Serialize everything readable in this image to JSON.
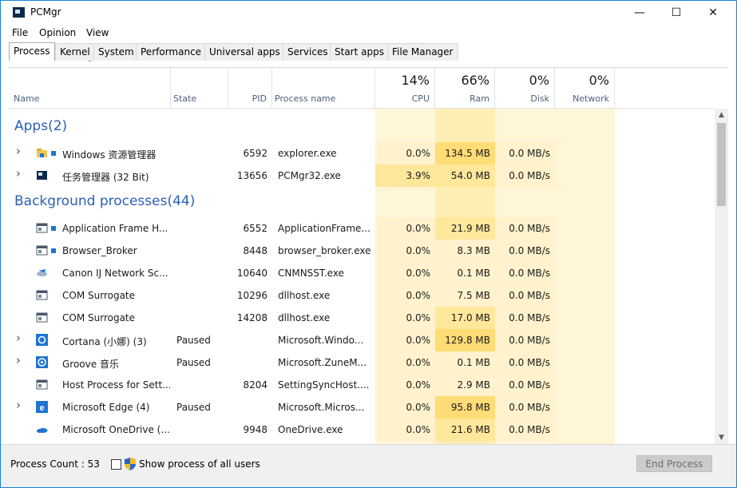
{
  "window": {
    "title": "PCMgr",
    "minimize_glyph": "—",
    "maximize_glyph": "☐",
    "close_glyph": "✕"
  },
  "menu": [
    "File",
    "Opinion",
    "View"
  ],
  "tabs": [
    "Process",
    "Kernel",
    "System",
    "Performance",
    "Universal apps",
    "Services",
    "Start apps",
    "File Manager"
  ],
  "active_tab": "Process",
  "columns": {
    "name": "Name",
    "state": "State",
    "pid": "PID",
    "process_name": "Process name",
    "cpu": {
      "label": "CPU",
      "pct": "14%"
    },
    "ram": {
      "label": "Ram",
      "pct": "66%"
    },
    "disk": {
      "label": "Disk",
      "pct": "0%"
    },
    "network": {
      "label": "Network",
      "pct": "0%"
    }
  },
  "groups": [
    {
      "title": "Apps(2)",
      "rows": [
        {
          "name": "Windows 资源管理器",
          "state": "",
          "pid": "6592",
          "process": "explorer.exe",
          "cpu": "0.0%",
          "ram": "134.5 MB",
          "disk": "0.0 MB/s",
          "expand": true,
          "icon": "folder-icon",
          "dot": true
        },
        {
          "name": "任务管理器 (32 Bit)",
          "state": "",
          "pid": "13656",
          "process": "PCMgr32.exe",
          "cpu": "3.9%",
          "ram": "54.0 MB",
          "disk": "0.0 MB/s",
          "expand": true,
          "icon": "taskmgr-icon",
          "dot": false
        }
      ]
    },
    {
      "title": "Background processes(44)",
      "rows": [
        {
          "name": "Application Frame H...",
          "state": "",
          "pid": "6552",
          "process": "ApplicationFrame...",
          "cpu": "0.0%",
          "ram": "21.9 MB",
          "disk": "0.0 MB/s",
          "expand": false,
          "icon": "window-icon",
          "dot": true
        },
        {
          "name": "Browser_Broker",
          "state": "",
          "pid": "8448",
          "process": "browser_broker.exe",
          "cpu": "0.0%",
          "ram": "8.3 MB",
          "disk": "0.0 MB/s",
          "expand": false,
          "icon": "window-icon",
          "dot": true
        },
        {
          "name": "Canon IJ Network Sc...",
          "state": "",
          "pid": "10640",
          "process": "CNMNSST.exe",
          "cpu": "0.0%",
          "ram": "0.1 MB",
          "disk": "0.0 MB/s",
          "expand": false,
          "icon": "scanner-icon",
          "dot": false
        },
        {
          "name": "COM Surrogate",
          "state": "",
          "pid": "10296",
          "process": "dllhost.exe",
          "cpu": "0.0%",
          "ram": "7.5 MB",
          "disk": "0.0 MB/s",
          "expand": false,
          "icon": "window-icon",
          "dot": false
        },
        {
          "name": "COM Surrogate",
          "state": "",
          "pid": "14208",
          "process": "dllhost.exe",
          "cpu": "0.0%",
          "ram": "17.0 MB",
          "disk": "0.0 MB/s",
          "expand": false,
          "icon": "window-icon",
          "dot": false
        },
        {
          "name": "Cortana (小娜) (3)",
          "state": "Paused",
          "pid": "",
          "process": "Microsoft.Windo...",
          "cpu": "0.0%",
          "ram": "129.8 MB",
          "disk": "0.0 MB/s",
          "expand": true,
          "icon": "cortana-icon",
          "dot": false
        },
        {
          "name": "Groove 音乐",
          "state": "Paused",
          "pid": "",
          "process": "Microsoft.ZuneM...",
          "cpu": "0.0%",
          "ram": "0.1 MB",
          "disk": "0.0 MB/s",
          "expand": true,
          "icon": "groove-icon",
          "dot": false
        },
        {
          "name": "Host Process for Sett...",
          "state": "",
          "pid": "8204",
          "process": "SettingSyncHost....",
          "cpu": "0.0%",
          "ram": "2.9 MB",
          "disk": "0.0 MB/s",
          "expand": false,
          "icon": "window-icon",
          "dot": false
        },
        {
          "name": "Microsoft Edge (4)",
          "state": "Paused",
          "pid": "",
          "process": "Microsoft.Micros...",
          "cpu": "0.0%",
          "ram": "95.8 MB",
          "disk": "0.0 MB/s",
          "expand": true,
          "icon": "edge-icon",
          "dot": false
        },
        {
          "name": "Microsoft OneDrive (...",
          "state": "",
          "pid": "9948",
          "process": "OneDrive.exe",
          "cpu": "0.0%",
          "ram": "21.6 MB",
          "disk": "0.0 MB/s",
          "expand": false,
          "icon": "onedrive-icon",
          "dot": false
        }
      ]
    }
  ],
  "footer": {
    "process_count": "Process Count : 53",
    "show_all_label": "Show process of all users",
    "end_process": "End Process"
  },
  "colors": {
    "accent": "#2b5fb4",
    "cpu_col": "#fff6d8",
    "ram_col": "#ffeeb4",
    "heat_light": "#fff2cc",
    "heat_mid": "#ffe79b",
    "heat_strong": "#ffdc75"
  }
}
